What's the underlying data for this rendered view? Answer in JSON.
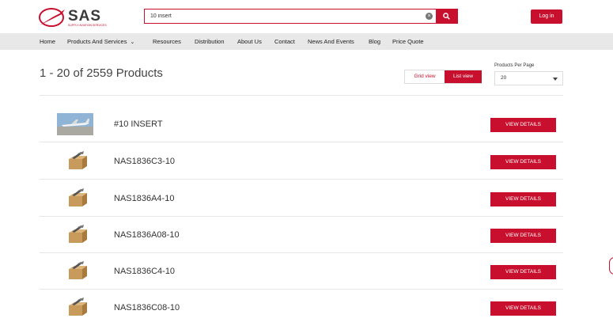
{
  "brand": {
    "name": "SAS",
    "tagline": "SUPPLY AVIATION SERVICES",
    "accent_color": "#c8102e"
  },
  "search": {
    "value": "10 insert",
    "clear_icon": "close-circle-icon",
    "submit_icon": "search-icon"
  },
  "header": {
    "login_label": "Log in"
  },
  "nav": {
    "items": [
      {
        "label": "Home"
      },
      {
        "label": "Products And Services",
        "has_dropdown": true
      },
      {
        "label": "Resources"
      },
      {
        "label": "Distribution"
      },
      {
        "label": "About Us"
      },
      {
        "label": "Contact"
      },
      {
        "label": "News And Events"
      },
      {
        "label": "Blog"
      },
      {
        "label": "Price Quote"
      }
    ]
  },
  "results": {
    "title": "1 - 20 of 2559 Products"
  },
  "view_toggle": {
    "grid_label": "Grid view",
    "list_label": "List view",
    "active": "list"
  },
  "per_page": {
    "label": "Products Per Page",
    "selected": "20"
  },
  "products": [
    {
      "name": "#10 INSERT",
      "image": "aircraft-photo",
      "button": "VIEW DETAILS"
    },
    {
      "name": "NAS1836C3-10",
      "image": "box-placeholder-icon",
      "button": "VIEW DETAILS"
    },
    {
      "name": "NAS1836A4-10",
      "image": "box-placeholder-icon",
      "button": "VIEW DETAILS"
    },
    {
      "name": "NAS1836A08-10",
      "image": "box-placeholder-icon",
      "button": "VIEW DETAILS"
    },
    {
      "name": "NAS1836C4-10",
      "image": "box-placeholder-icon",
      "button": "VIEW DETAILS"
    },
    {
      "name": "NAS1836C08-10",
      "image": "box-placeholder-icon",
      "button": "VIEW DETAILS"
    }
  ]
}
